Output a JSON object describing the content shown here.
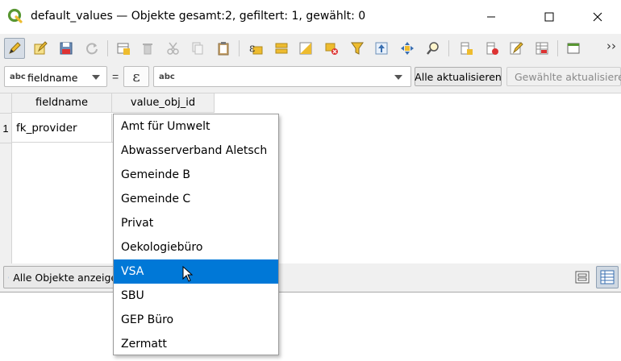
{
  "window": {
    "title": "default_values — Objekte gesamt:2, gefiltert: 1, gewählt: 0"
  },
  "toolbar": {
    "icons": [
      "edit-pencil-icon",
      "multi-edit-icon",
      "save-edits-icon",
      "reload-icon",
      "add-feature-icon",
      "delete-feature-icon",
      "cut-icon",
      "copy-icon",
      "paste-icon",
      "expression-select-icon",
      "select-all-icon",
      "invert-selection-icon",
      "deselect-icon",
      "filter-icon",
      "move-top-icon",
      "pan-map-icon",
      "zoom-map-icon",
      "new-field-icon",
      "delete-field-icon",
      "field-calculator-icon",
      "conditional-format-icon",
      "dock-icon"
    ],
    "overflow": "››"
  },
  "filter": {
    "field_prefix": "abc",
    "field_value": "fieldname",
    "equals": "=",
    "expression_symbol": "ε",
    "value_prefix": "abc",
    "update_all_label": "Alle aktualisieren",
    "update_selected_label": "Gewählte aktualisieren"
  },
  "table": {
    "columns": [
      "fieldname",
      "value_obj_id"
    ],
    "rows": [
      {
        "index": "1",
        "fieldname": "fk_provider",
        "value_obj_id": ""
      }
    ]
  },
  "bottom": {
    "show_all_label": "Alle Objekte anzeigen"
  },
  "dropdown": {
    "items": [
      "Amt für Umwelt",
      "Abwasserverband Aletsch",
      "Gemeinde B",
      "Gemeinde C",
      "Privat",
      "Oekologiebüro",
      "VSA",
      "SBU",
      "GEP Büro",
      "Zermatt"
    ],
    "selected": "VSA"
  },
  "colors": {
    "selection": "#0078d7",
    "qgis_green": "#589632",
    "qgis_yellow": "#eebc2f"
  }
}
